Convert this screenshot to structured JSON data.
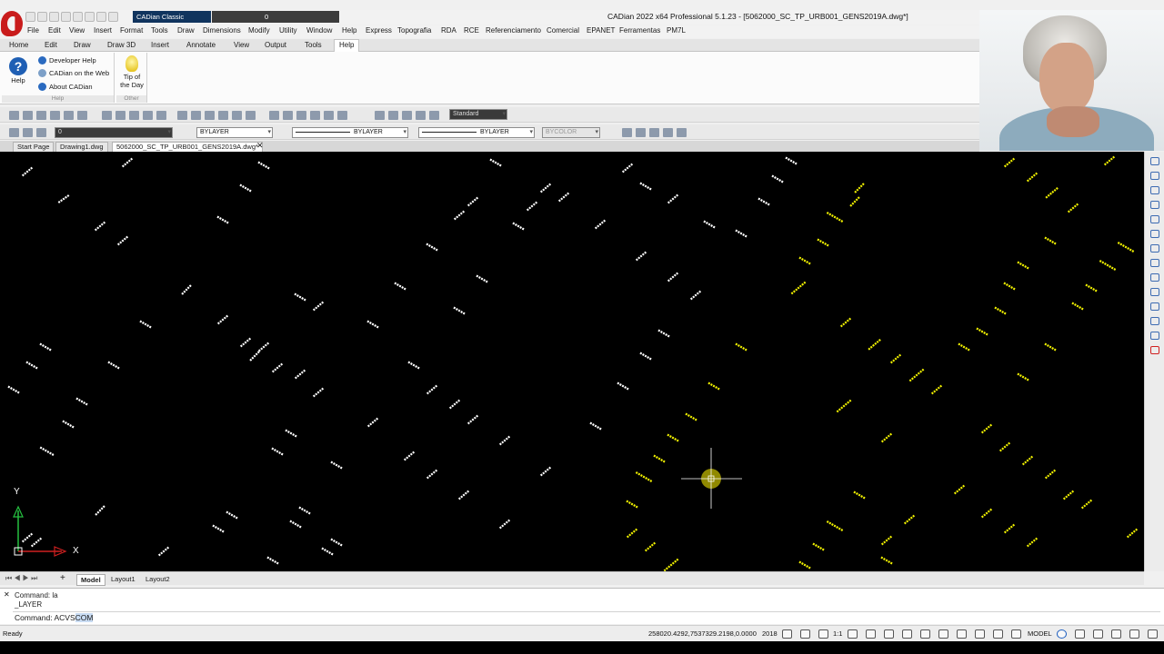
{
  "window": {
    "workspace": "CADian Classic",
    "quick_layer": "0",
    "title": "CADian 2022 x64 Professional 5.1.23 - [5062000_SC_TP_URB001_GENS2019A.dwg*]"
  },
  "menu": [
    "File",
    "Edit",
    "View",
    "Insert",
    "Format",
    "Tools",
    "Draw",
    "Dimensions",
    "Modify",
    "Utility",
    "Window",
    "Help",
    "Express",
    "Topografia",
    "RDA",
    "RCE",
    "Referenciamento",
    "Comercial",
    "EPANET",
    "Ferramentas",
    "PM7L"
  ],
  "ribbon_tabs": [
    "Home",
    "Edit",
    "Draw",
    "Draw 3D",
    "Insert",
    "Annotate",
    "View",
    "Output",
    "Tools",
    "Help"
  ],
  "ribbon": {
    "help_label": "Help",
    "developer_help": "Developer Help",
    "cadian_web": "CADian on the Web",
    "about": "About CADian",
    "group_help": "Help",
    "tip_line1": "Tip of",
    "tip_line2": "the Day",
    "group_other": "Other"
  },
  "toolbar": {
    "text_style": "Standard",
    "layer": "0",
    "color": "BYLAYER",
    "linetype": "BYLAYER",
    "lineweight": "BYLAYER",
    "plot_style": "BYCOLOR"
  },
  "doc_tabs": [
    "Start Page",
    "Drawing1.dwg",
    "5062000_SC_TP_URB001_GENS2019A.dwg*"
  ],
  "ucs": {
    "x": "X",
    "y": "Y"
  },
  "layout_tabs": [
    "Model",
    "Layout1",
    "Layout2"
  ],
  "command": {
    "history1": "Command: la",
    "history2": "_LAYER",
    "prompt": "Command: ACVS",
    "highlight": "COM"
  },
  "status": {
    "ready": "Ready",
    "coords": "258020.4292,7537329.2198,0.0000",
    "year": "2018",
    "scale": "1:1",
    "mode": "MODEL"
  },
  "colors": {
    "white_marks": "#ffffff",
    "yellow_marks": "#f2f200",
    "canvas": "#000000"
  }
}
